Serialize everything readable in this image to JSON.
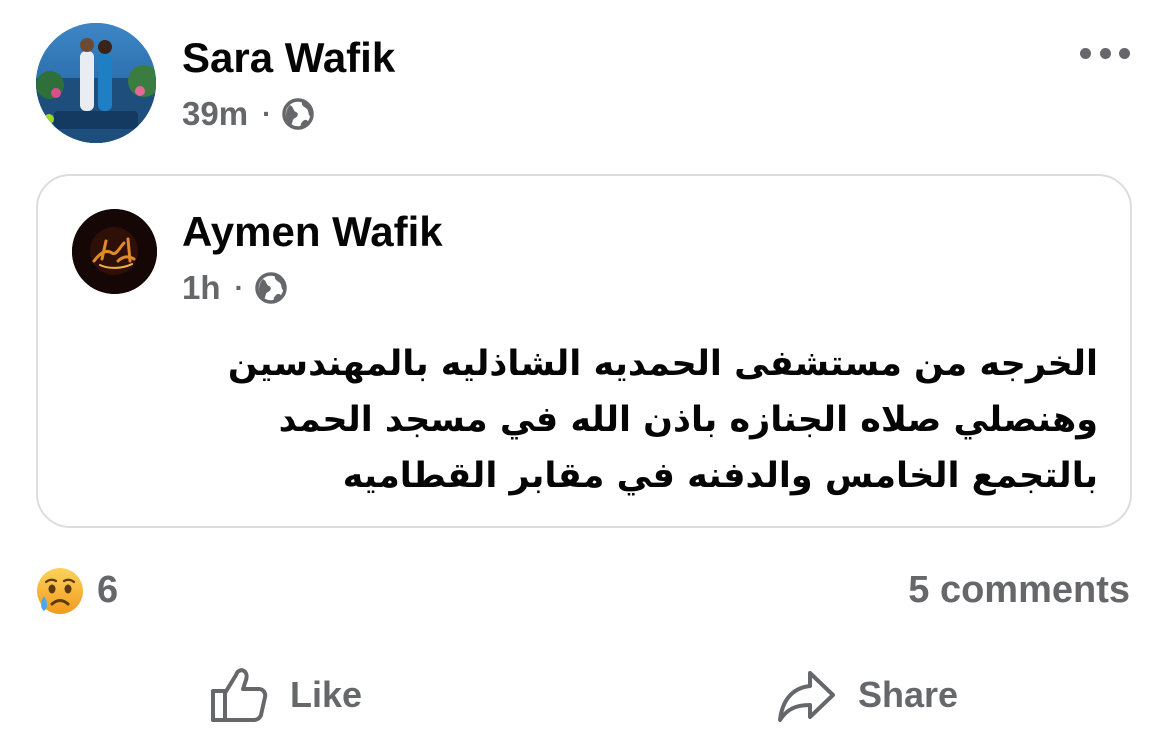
{
  "post": {
    "author": "Sara Wafik",
    "time": "39m",
    "separator": "·",
    "privacy_icon": "globe-icon",
    "more_icon": "more-horizontal-icon"
  },
  "shared_post": {
    "author": "Aymen Wafik",
    "time": "1h",
    "separator": "·",
    "privacy_icon": "globe-icon",
    "text_lines": [
      "الخرجه من مستشفى الحمديه الشاذليه بالمهندسين",
      "وهنصلي صلاه الجنازه باذن الله في مسجد الحمد",
      "بالتجمع الخامس والدفنه في مقابر القطاميه"
    ]
  },
  "reactions": {
    "icon": "sad-reaction-icon",
    "count": "6",
    "comments": "5 comments"
  },
  "actions": {
    "like_label": "Like",
    "share_label": "Share"
  },
  "colors": {
    "text_primary": "#050505",
    "text_secondary": "#65676b",
    "card_border": "#dadde1",
    "reaction_face": "#f7b125"
  }
}
